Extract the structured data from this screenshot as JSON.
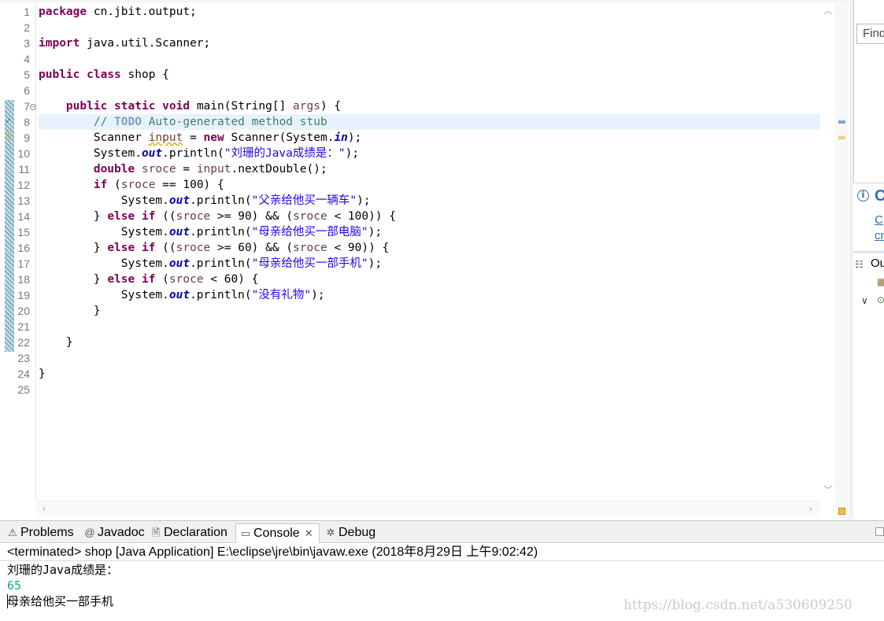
{
  "editor": {
    "line_numbers": [
      "1",
      "2",
      "3",
      "4",
      "5",
      "6",
      "7",
      "8",
      "9",
      "10",
      "11",
      "12",
      "13",
      "14",
      "15",
      "16",
      "17",
      "18",
      "19",
      "20",
      "21",
      "22",
      "23",
      "24",
      "25"
    ],
    "code": {
      "l1_kw": "package",
      "l1_rest": " cn.jbit.output;",
      "l3_kw": "import",
      "l3_rest": " java.util.Scanner;",
      "l5_kw1": "public",
      "l5_kw2": "class",
      "l5_rest": " shop {",
      "l7_indent": "    ",
      "l7_kw1": "public",
      "l7_kw2": "static",
      "l7_kw3": "void",
      "l7_mid": " main(String[] ",
      "l7_param": "args",
      "l7_end": ") {",
      "l8_indent": "        ",
      "l8_comment_start": "// ",
      "l8_todo": "TODO",
      "l8_comment_rest": " Auto-generated method stub",
      "l9_indent": "        ",
      "l9_type": "Scanner ",
      "l9_var": "input",
      "l9_eq": " = ",
      "l9_new": "new",
      "l9_mid": " Scanner(System.",
      "l9_field": "in",
      "l9_end": ");",
      "l10_indent": "        ",
      "l10_pre": "System.",
      "l10_field": "out",
      "l10_mid": ".println(",
      "l10_str": "\"刘珊的Java成绩是：\"",
      "l10_end": ");",
      "l11_indent": "        ",
      "l11_kw": "double",
      "l11_sp": " ",
      "l11_var": "sroce",
      "l11_mid": " = ",
      "l11_var2": "input",
      "l11_end": ".nextDouble();",
      "l12_indent": "        ",
      "l12_kw": "if",
      "l12_pre": " (",
      "l12_var": "sroce",
      "l12_end": " == 100) {",
      "l13_indent": "            ",
      "l13_pre": "System.",
      "l13_field": "out",
      "l13_mid": ".println(",
      "l13_str": "\"父亲给他买一辆车\"",
      "l13_end": ");",
      "l14_indent": "        ",
      "l14_brace": "} ",
      "l14_kw1": "else",
      "l14_sp": " ",
      "l14_kw2": "if",
      "l14_p1": " ((",
      "l14_var1": "sroce",
      "l14_p2": " >= 90) && (",
      "l14_var2": "sroce",
      "l14_end": " < 100)) {",
      "l15_indent": "            ",
      "l15_pre": "System.",
      "l15_field": "out",
      "l15_mid": ".println(",
      "l15_str": "\"母亲给他买一部电脑\"",
      "l15_end": ");",
      "l16_indent": "        ",
      "l16_brace": "} ",
      "l16_kw1": "else",
      "l16_sp": " ",
      "l16_kw2": "if",
      "l16_p1": " ((",
      "l16_var1": "sroce",
      "l16_p2": " >= 60) && (",
      "l16_var2": "sroce",
      "l16_end": " < 90)) {",
      "l17_indent": "            ",
      "l17_pre": "System.",
      "l17_field": "out",
      "l17_mid": ".println(",
      "l17_str": "\"母亲给他买一部手机\"",
      "l17_end": ");",
      "l18_indent": "        ",
      "l18_brace": "} ",
      "l18_kw1": "else",
      "l18_sp": " ",
      "l18_kw2": "if",
      "l18_p1": " (",
      "l18_var": "sroce",
      "l18_end": " < 60) {",
      "l19_indent": "            ",
      "l19_pre": "System.",
      "l19_field": "out",
      "l19_mid": ".println(",
      "l19_str": "\"没有礼物\"",
      "l19_end": ");",
      "l20_text": "        }",
      "l22_text": "    }",
      "l24_text": "}"
    }
  },
  "right_pane": {
    "find_placeholder": "Find",
    "info_title": "C",
    "info_link_1": "C",
    "info_link_2": "cr",
    "outline_title": "Ou"
  },
  "bottom_panel": {
    "tabs": {
      "problems": "Problems",
      "javadoc": "Javadoc",
      "declaration": "Declaration",
      "console": "Console",
      "debug": "Debug"
    },
    "console_header": "<terminated> shop [Java Application] E:\\eclipse\\jre\\bin\\javaw.exe (2018年8月29日 上午9:02:42)",
    "output_line_1": "刘珊的Java成绩是：",
    "input_line": "65",
    "output_line_2": "母亲给他买一部手机",
    "watermark": "https://blog.csdn.net/a530609250"
  },
  "colors": {
    "keyword": "#7f0055",
    "string": "#2a00ff",
    "comment": "#3f7f5f",
    "field": "#0000c0",
    "console_input": "#17a589",
    "link": "#2f6fb0"
  }
}
